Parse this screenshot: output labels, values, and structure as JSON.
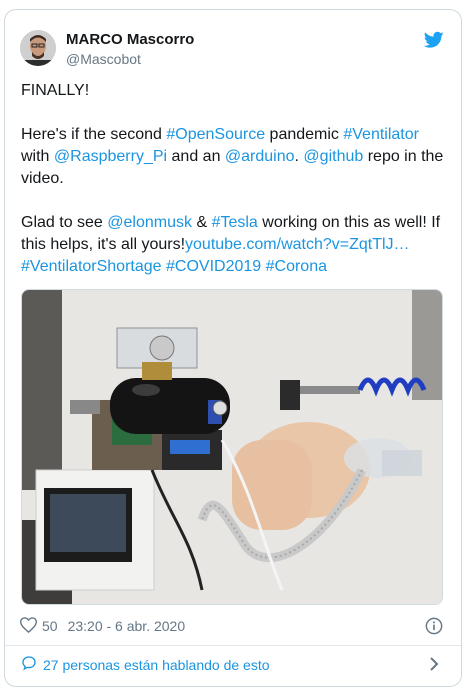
{
  "author": {
    "name": "MARCO Mascorro",
    "handle": "@Mascobot"
  },
  "icons": {
    "brand": "twitter-bird-icon",
    "like": "heart-icon",
    "info": "info-icon",
    "reply": "speech-bubble-icon",
    "chevron": "chevron-right-icon"
  },
  "tweet": {
    "line1": "FINALLY!",
    "p2": {
      "t1": "Here's if the second ",
      "l1": "#OpenSource",
      "t2": " pandemic ",
      "l2": "#Ventilator",
      "t3": " with ",
      "l3": "@Raspberry_Pi",
      "t4": " and an ",
      "l4": "@arduino",
      "t5": ". ",
      "l5": "@github",
      "t6": " repo in the video."
    },
    "p3": {
      "t1": "Glad to see ",
      "l1": "@elonmusk",
      "t2": " & ",
      "l2": "#Tesla",
      "t3": " working on this as well! If this helps, it's all yours!",
      "l3": "youtube.com/watch?v=ZqtTlJ…",
      "l4": "#VentilatorShortage",
      "l5": "#COVID2019",
      "l6": "#Corona"
    }
  },
  "meta": {
    "likes": "50",
    "timestamp": "23:20 - 6 abr. 2020"
  },
  "footer": {
    "conversation": "27 personas están hablando de esto"
  },
  "colors": {
    "link": "#1b95e0",
    "text": "#14171a",
    "muted": "#657786",
    "border": "#cfd9de"
  }
}
